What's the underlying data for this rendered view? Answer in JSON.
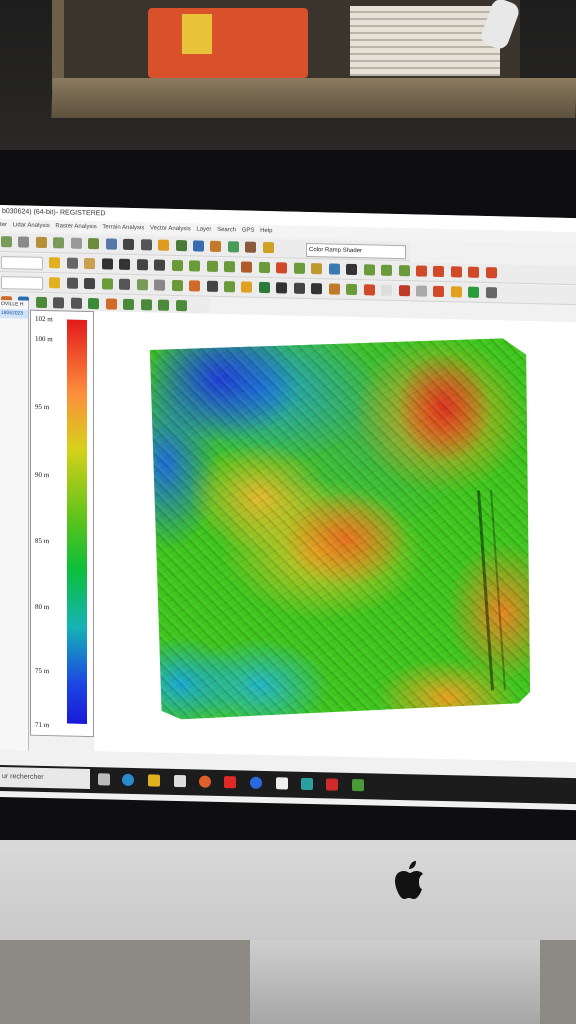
{
  "window": {
    "title": "b030624) (64-bit)- REGISTERED"
  },
  "menu": {
    "items": [
      "ter",
      "Lidar Analysis",
      "Raster Analysis",
      "Terrain Analysis",
      "Vector Analysis",
      "Layer",
      "Search",
      "GPS",
      "Help"
    ]
  },
  "toolbar": {
    "shader_combo": "Color Ramp Shader"
  },
  "layers": {
    "items": [
      "OVILLE H",
      "18062025"
    ]
  },
  "legend": {
    "labels": [
      "102 m",
      "100 m",
      "95 m",
      "90 m",
      "85 m",
      "80 m",
      "75 m",
      "71 m"
    ]
  },
  "taskbar": {
    "search_text": "ur rechercher"
  },
  "colors": {
    "ramp_high": "#e31a1c",
    "ramp_mid": "#59c21b",
    "ramp_low": "#1919d8"
  }
}
